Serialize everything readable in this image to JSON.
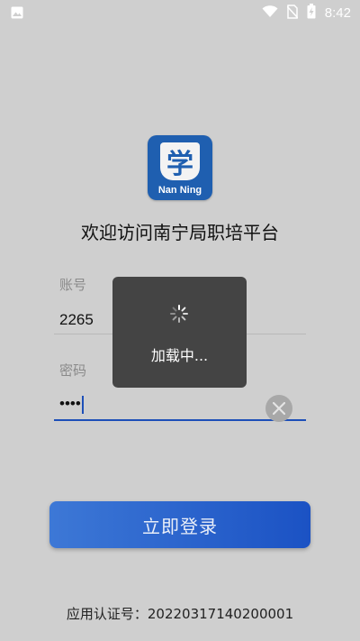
{
  "status_bar": {
    "time": "8:42",
    "icons": [
      "image-icon",
      "wifi-icon",
      "no-sim-icon",
      "battery-charging-icon"
    ]
  },
  "app": {
    "logo_char": "学",
    "logo_caption": "Nan Ning",
    "welcome": "欢迎访问南宁局职培平台"
  },
  "form": {
    "account_label": "账号",
    "account_value": "2265",
    "password_label": "密码",
    "password_value": "••••",
    "login_button": "立即登录"
  },
  "footer": {
    "cert": "应用认证号：20220317140200001"
  },
  "loading": {
    "text": "加载中..."
  }
}
